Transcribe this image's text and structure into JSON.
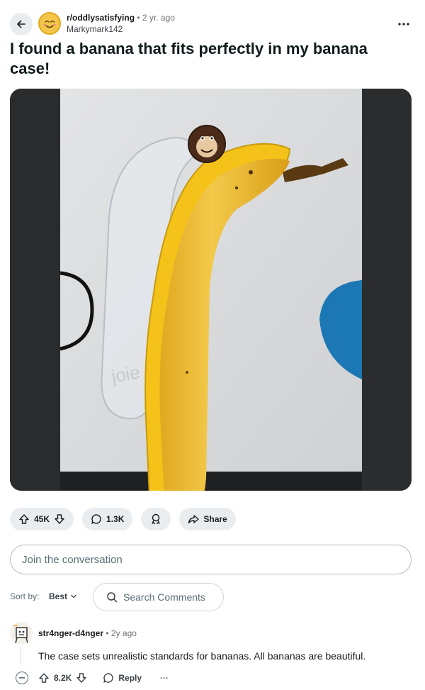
{
  "post": {
    "subreddit": "r/oddlysatisfying",
    "separator": "•",
    "age": "2 yr. ago",
    "author": "Markymark142",
    "title": "I found a banana that fits perfectly in my banana case!",
    "media_brand_text": "joie",
    "upvotes": "45K",
    "comments": "1.3K",
    "share_label": "Share"
  },
  "composer": {
    "placeholder": "Join the conversation"
  },
  "sort": {
    "label": "Sort by:",
    "value": "Best"
  },
  "search": {
    "placeholder": "Search Comments"
  },
  "comment": {
    "author": "str4nger-d4nger",
    "separator": "•",
    "age": "2y ago",
    "body": "The case sets unrealistic standards for bananas. All bananas are beautiful.",
    "votes": "8.2K",
    "reply_label": "Reply",
    "more": "···"
  },
  "icons": [
    "back-arrow-icon",
    "subreddit-icon",
    "more-icon",
    "upvote-icon",
    "downvote-icon",
    "comment-icon",
    "award-icon",
    "share-icon",
    "search-icon",
    "chevron-down-icon",
    "collapse-icon"
  ],
  "colors": {
    "pill_bg": "#eaedef",
    "banana": "#f0c130",
    "case_yellow": "#f5c21a"
  }
}
